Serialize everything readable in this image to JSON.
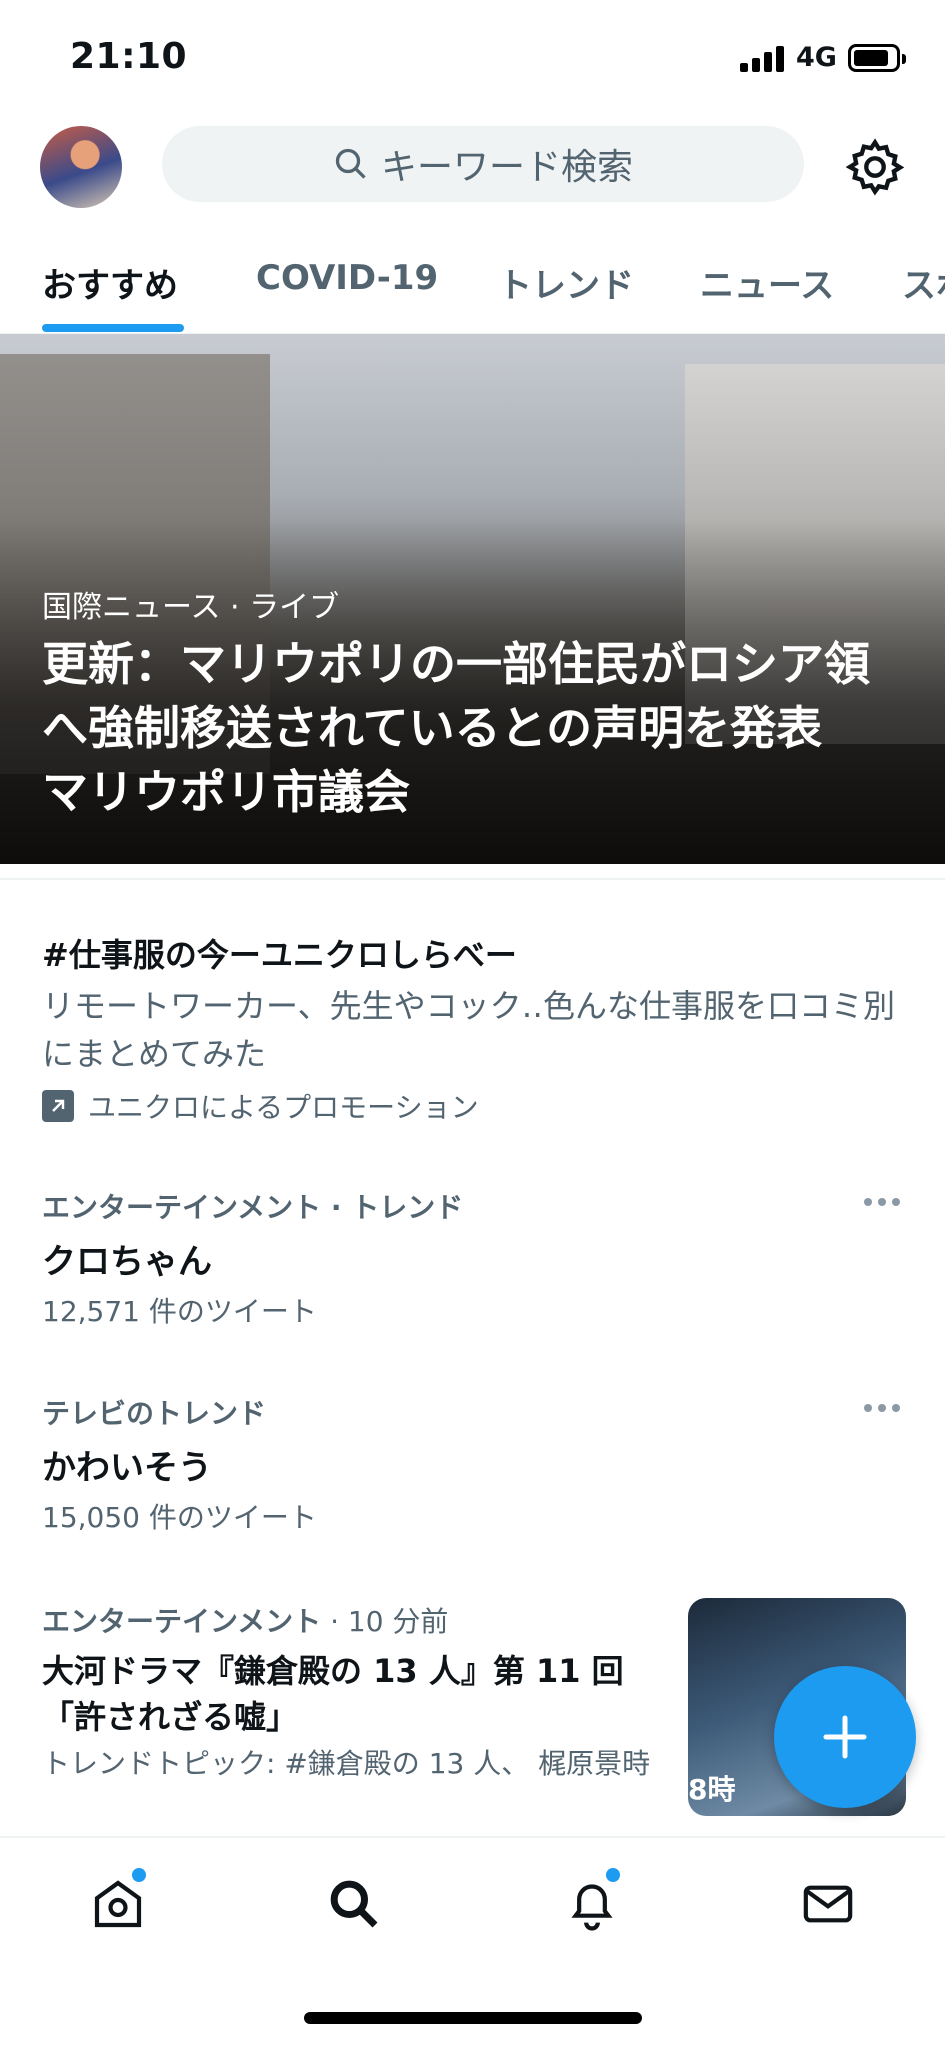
{
  "status_bar": {
    "time": "21:10",
    "network": "4G"
  },
  "header": {
    "search_placeholder": "キーワード検索"
  },
  "tabs": [
    {
      "label": "おすすめ"
    },
    {
      "label": "COVID-19"
    },
    {
      "label": "トレンド"
    },
    {
      "label": "ニュース"
    },
    {
      "label": "スポ"
    }
  ],
  "hero": {
    "meta": "国際ニュース · ライブ",
    "title": "更新：マリウポリの一部住民がロシア領へ強制移送されているとの声明を発表　マリウポリ市議会"
  },
  "promo": {
    "title": "#仕事服の今ーユニクロしらべー",
    "description": "リモートワーカー、先生やコック‥色んな仕事服を口コミ別にまとめてみた",
    "sponsor": "ユニクロによるプロモーション"
  },
  "trends": [
    {
      "meta": "エンターテインメント · トレンド",
      "title": "クロちゃん",
      "count": "12,571 件のツイート"
    },
    {
      "meta": "テレビのトレンド",
      "title": "かわいそう",
      "count": "15,050 件のツイート"
    }
  ],
  "news": {
    "category": "エンターテインメント",
    "time": " · 10 分前",
    "title": "大河ドラマ『鎌倉殿の 13 人』第 11 回「許されざる嘘」",
    "topic": "トレンドトピック: #鎌倉殿の 13 人、 梶原景時",
    "thumb_text": "8時"
  },
  "colors": {
    "accent": "#1d9bf0",
    "secondary_text": "#536471",
    "primary_text": "#0f1419"
  }
}
